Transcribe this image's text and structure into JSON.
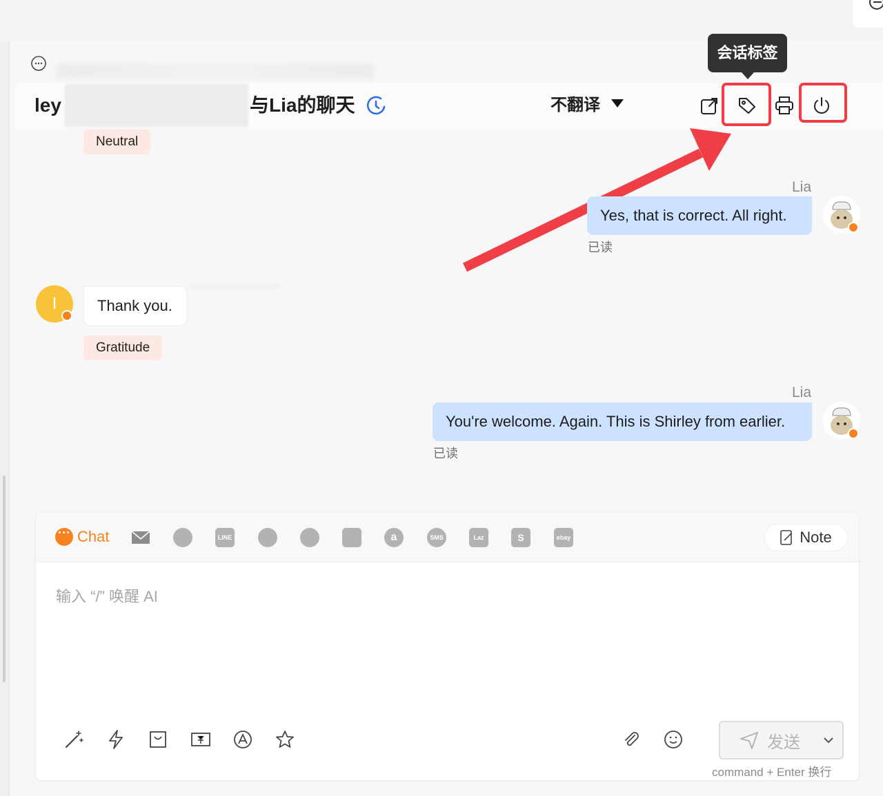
{
  "tooltip": {
    "text": "会话标签"
  },
  "header": {
    "title_prefix": "ley",
    "title_suffix": "与Lia的聊天",
    "translate_label": "不翻译"
  },
  "messages": [
    {
      "direction": "in",
      "tag": "Neutral"
    },
    {
      "direction": "out",
      "sender": "Lia",
      "text": "Yes, that is correct. All right.",
      "status": "已读"
    },
    {
      "direction": "in",
      "avatar_letter": "I",
      "text": "Thank you.",
      "tag": "Gratitude"
    },
    {
      "direction": "out",
      "sender": "Lia",
      "text": "You're welcome. Again. This is Shirley from earlier.",
      "status": "已读"
    }
  ],
  "composer": {
    "active_channel": "Chat",
    "channels": [
      "mail-icon",
      "whatsapp-icon",
      "line-icon",
      "tiktok-icon",
      "messenger-icon",
      "instagram-icon",
      "amazon-icon",
      "sms-icon",
      "lazada-icon",
      "shopee-icon",
      "ebay-icon"
    ],
    "channel_glyphs": {
      "line": "LINE",
      "sms": "SMS",
      "lazada": "Laz",
      "shopee": "S",
      "ebay": "ebay",
      "amazon": "a"
    },
    "note_label": "Note",
    "placeholder": "输入 “/” 唤醒 AI",
    "send_label": "发送",
    "send_hint": "command + Enter 换行"
  },
  "colors": {
    "accent_orange": "#f5821f",
    "highlight_red": "#ef3e46",
    "bubble_blue": "#cde2ff",
    "tag_bg": "#fde9e3"
  }
}
